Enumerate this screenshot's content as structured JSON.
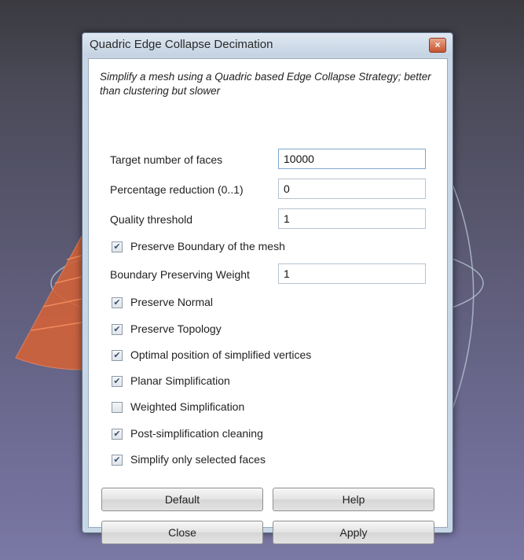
{
  "dialog": {
    "title": "Quadric Edge Collapse Decimation",
    "close_glyph": "×",
    "description": "Simplify a mesh using a Quadric based Edge Collapse Strategy; better than clustering but slower"
  },
  "fields": {
    "target_faces": {
      "label": "Target number of faces",
      "value": "10000"
    },
    "percentage_reduction": {
      "label": "Percentage reduction (0..1)",
      "value": "0"
    },
    "quality_threshold": {
      "label": "Quality threshold",
      "value": "1"
    },
    "boundary_weight": {
      "label": "Boundary Preserving Weight",
      "value": "1"
    }
  },
  "checkboxes": [
    {
      "label": "Preserve Boundary of the mesh",
      "checked": true
    },
    {
      "label": "Preserve Normal",
      "checked": true
    },
    {
      "label": "Preserve Topology",
      "checked": true
    },
    {
      "label": "Optimal position of simplified vertices",
      "checked": true
    },
    {
      "label": "Planar Simplification",
      "checked": true
    },
    {
      "label": "Weighted Simplification",
      "checked": false
    },
    {
      "label": "Post-simplification cleaning",
      "checked": true
    },
    {
      "label": "Simplify only selected faces",
      "checked": true
    }
  ],
  "buttons": {
    "default": "Default",
    "help": "Help",
    "close": "Close",
    "apply": "Apply"
  },
  "colors": {
    "mesh": "#d2623a",
    "background_top": "#3a3a40",
    "background_bottom": "#7a78a4"
  }
}
